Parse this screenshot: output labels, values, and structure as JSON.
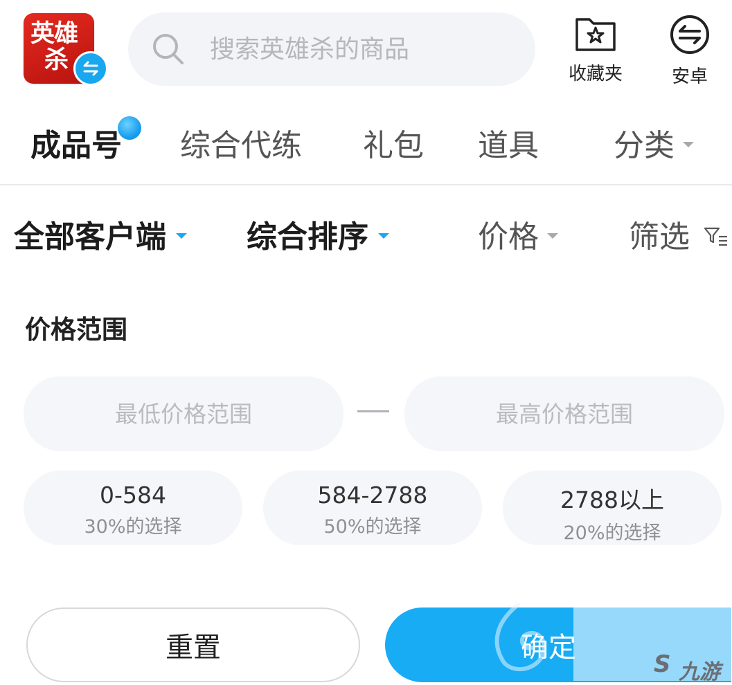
{
  "header": {
    "logo_line1": "英雄",
    "logo_line2": "杀",
    "search_placeholder": "搜索英雄杀的商品",
    "favorites_label": "收藏夹",
    "android_label": "安卓"
  },
  "tabs": [
    {
      "label": "成品号",
      "active": true
    },
    {
      "label": "综合代练",
      "active": false
    },
    {
      "label": "礼包",
      "active": false
    },
    {
      "label": "道具",
      "active": false
    },
    {
      "label": "分类",
      "active": false
    }
  ],
  "filters": {
    "client": "全部客户端",
    "sort": "综合排序",
    "price": "价格",
    "screen": "筛选"
  },
  "price_range": {
    "title": "价格范围",
    "min_placeholder": "最低价格范围",
    "max_placeholder": "最高价格范围",
    "presets": [
      {
        "range": "0-584",
        "share": "30%的选择"
      },
      {
        "range": "584-2788",
        "share": "50%的选择"
      },
      {
        "range": "2788以上",
        "share": "20%的选择"
      }
    ]
  },
  "actions": {
    "reset": "重置",
    "confirm": "确定"
  },
  "watermark": {
    "brand": "九游"
  },
  "colors": {
    "accent": "#17acf4",
    "logo_red": "#d01f17",
    "text_dark": "#1c1c1c"
  }
}
